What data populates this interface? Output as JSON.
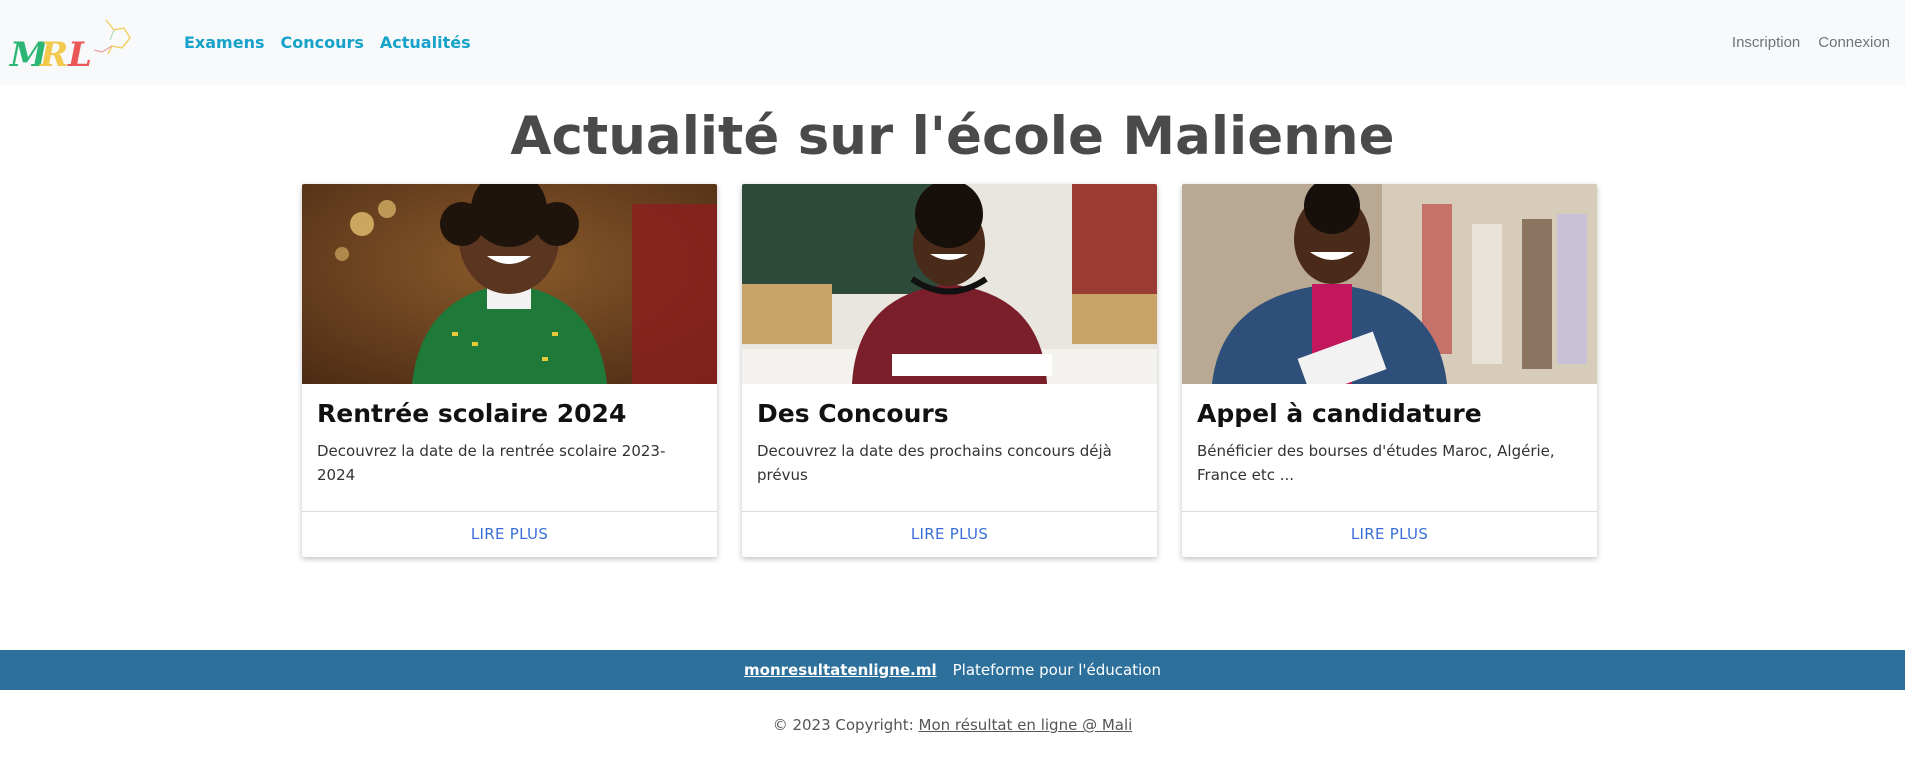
{
  "navbar": {
    "logo_text": "MRL",
    "links": [
      "Examens",
      "Concours",
      "Actualités"
    ],
    "right_links": [
      "Inscription",
      "Connexion"
    ]
  },
  "main": {
    "title": "Actualité sur l'école Malienne",
    "cards": [
      {
        "title": "Rentrée scolaire 2024",
        "text": "Decouvrez la date de la rentrée scolaire 2023-2024",
        "button": "LIRE PLUS"
      },
      {
        "title": "Des Concours",
        "text": "Decouvrez la date des prochains concours déjà prévus",
        "button": "LIRE PLUS"
      },
      {
        "title": "Appel à candidature",
        "text": "Bénéficier des bourses d'études Maroc, Algérie, France etc ...",
        "button": "LIRE PLUS"
      }
    ]
  },
  "footer": {
    "site_link": "monresultatenligne.ml",
    "tagline": "Plateforme pour l'éducation",
    "copyright_prefix": "© 2023 Copyright:",
    "copyright_link": "Mon résultat en ligne @ Mali"
  },
  "colors": {
    "nav_link": "#17a2c9",
    "footer_band": "#2e709c",
    "card_button": "#3b6fd8",
    "title": "#4a4a4a"
  }
}
